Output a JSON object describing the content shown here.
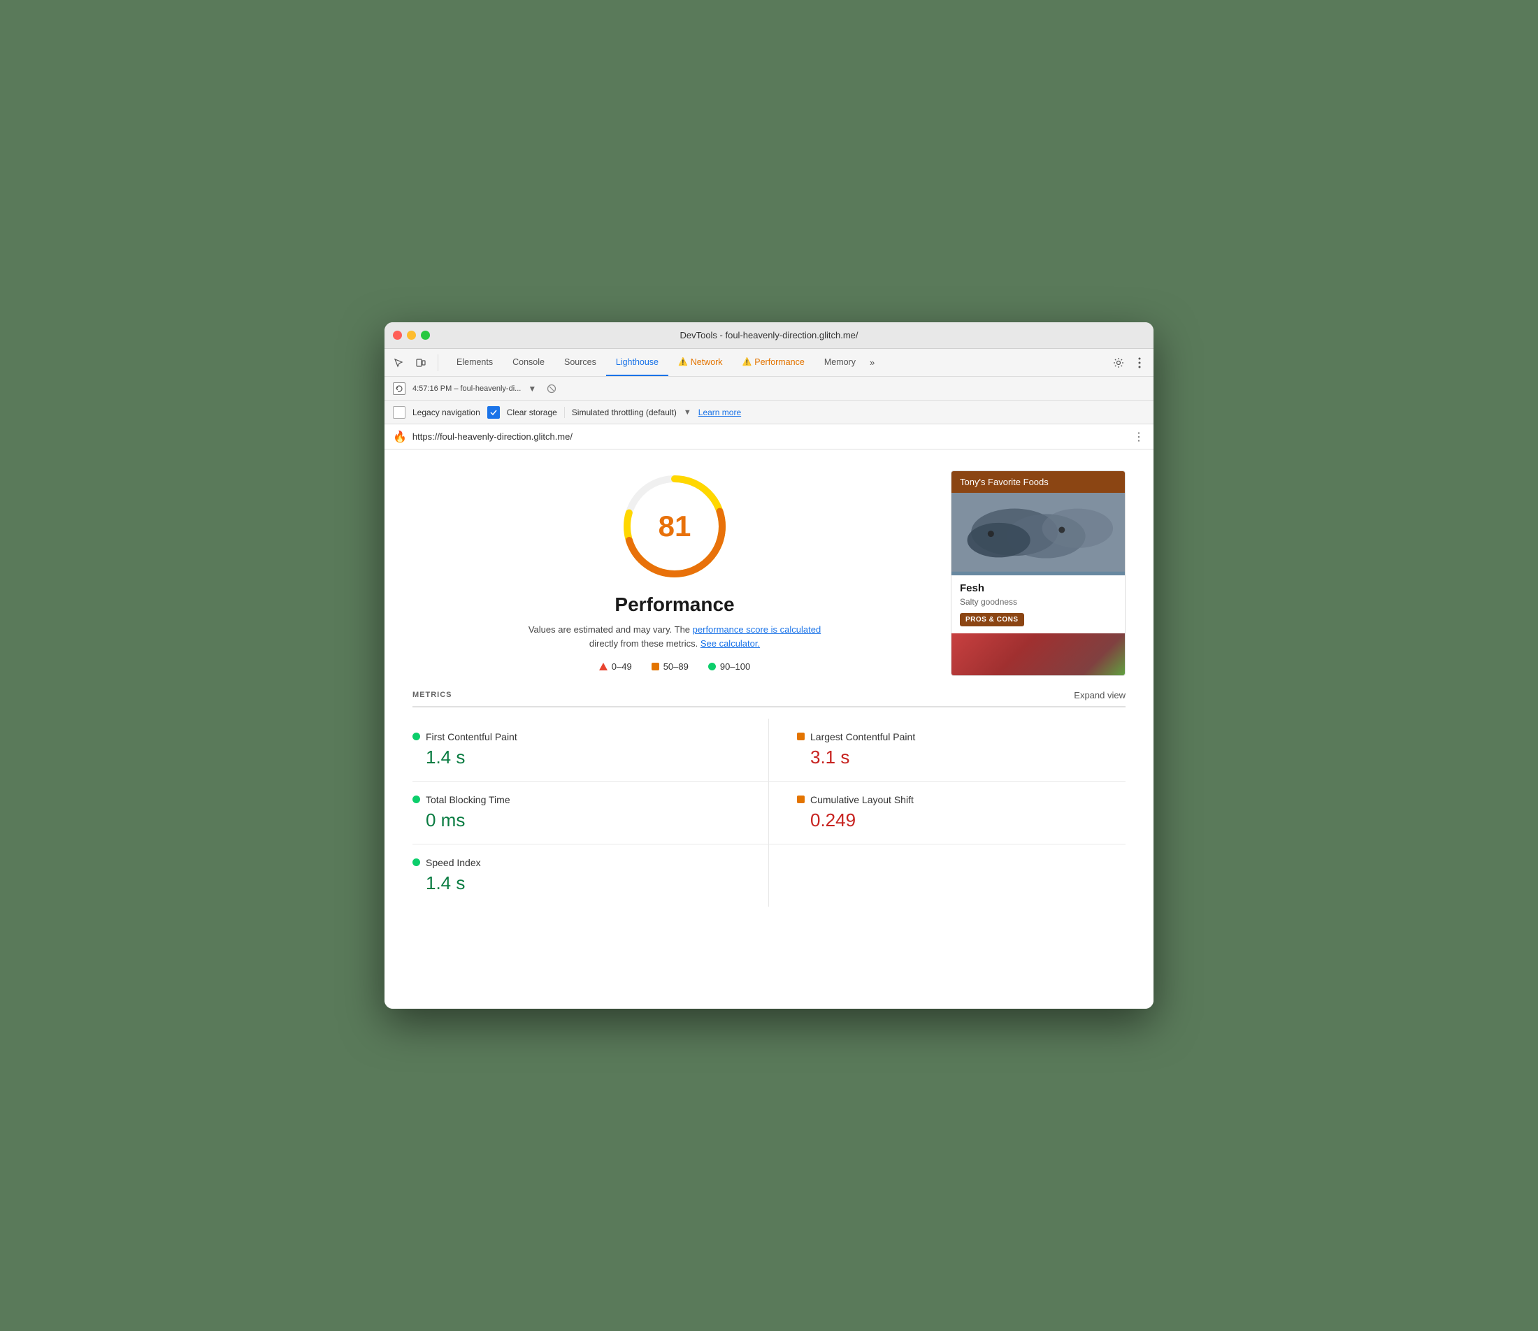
{
  "window": {
    "title": "DevTools - foul-heavenly-direction.glitch.me/"
  },
  "nav": {
    "tabs": [
      {
        "label": "Elements",
        "active": false,
        "warning": false
      },
      {
        "label": "Console",
        "active": false,
        "warning": false
      },
      {
        "label": "Sources",
        "active": false,
        "warning": false
      },
      {
        "label": "Lighthouse",
        "active": true,
        "warning": false
      },
      {
        "label": "Network",
        "active": false,
        "warning": true
      },
      {
        "label": "Performance",
        "active": false,
        "warning": true
      },
      {
        "label": "Memory",
        "active": false,
        "warning": false
      }
    ],
    "more_label": "»"
  },
  "toolbar": {
    "session_label": "4:57:16 PM – foul-heavenly-di...",
    "legacy_nav_label": "Legacy navigation",
    "clear_storage_label": "Clear storage",
    "throttle_label": "Simulated throttling (default)",
    "learn_more_label": "Learn more"
  },
  "url_bar": {
    "favicon": "🔥",
    "url": "https://foul-heavenly-direction.glitch.me/"
  },
  "score": {
    "value": "81",
    "title": "Performance",
    "description_pre": "Values are estimated and may vary. The ",
    "description_link1": "performance score is calculated",
    "description_mid": " directly from these metrics. ",
    "description_link2": "See calculator.",
    "legend": [
      {
        "type": "triangle",
        "label": "0–49"
      },
      {
        "type": "square",
        "label": "50–89"
      },
      {
        "type": "circle",
        "label": "90–100"
      }
    ]
  },
  "preview": {
    "header": "Tony's Favorite Foods",
    "item_name": "Fesh",
    "item_desc": "Salty goodness",
    "btn_label": "PROS & CONS"
  },
  "metrics": {
    "section_title": "METRICS",
    "expand_label": "Expand view",
    "items": [
      {
        "name": "First Contentful Paint",
        "value": "1.4 s",
        "status": "green",
        "position": "left"
      },
      {
        "name": "Largest Contentful Paint",
        "value": "3.1 s",
        "status": "red",
        "position": "right"
      },
      {
        "name": "Total Blocking Time",
        "value": "0 ms",
        "status": "green",
        "position": "left"
      },
      {
        "name": "Cumulative Layout Shift",
        "value": "0.249",
        "status": "orange",
        "position": "right"
      },
      {
        "name": "Speed Index",
        "value": "1.4 s",
        "status": "green",
        "position": "left"
      }
    ]
  }
}
